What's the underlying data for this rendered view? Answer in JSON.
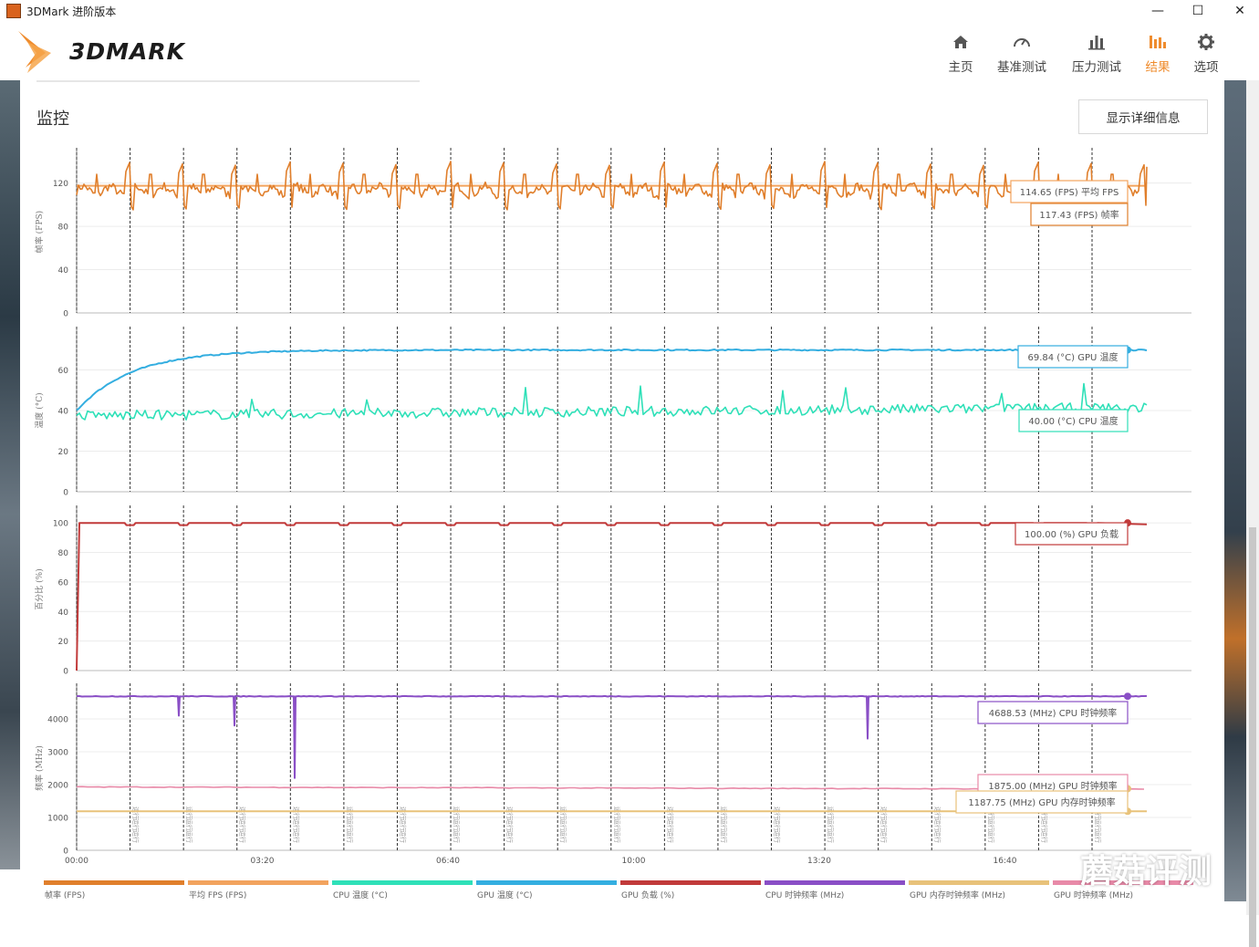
{
  "window": {
    "title": "3DMark 进阶版本",
    "minimize_glyph": "—",
    "maximize_glyph": "☐",
    "close_glyph": "✕"
  },
  "header": {
    "logo_text": "3DMARK",
    "nav": [
      {
        "label": "主页",
        "icon": "home-icon"
      },
      {
        "label": "基准测试",
        "icon": "gauge-icon"
      },
      {
        "label": "压力测试",
        "icon": "bar-chart-icon"
      },
      {
        "label": "结果",
        "icon": "results-icon",
        "active": true
      },
      {
        "label": "选项",
        "icon": "gear-icon"
      }
    ]
  },
  "monitor": {
    "title": "监控",
    "detail_button": "显示详细信息"
  },
  "watermark": "蘑菇评测",
  "colors": {
    "accent": "#ef8c2e",
    "fps": "#e07f2c",
    "avg_fps": "#f2a35e",
    "cpu_temp": "#2fe0b8",
    "gpu_temp": "#34aee0",
    "gpu_load": "#c13a3a",
    "cpu_clock": "#8a4fc6",
    "gpu_mem_clock": "#e8c27a",
    "gpu_clock": "#e88aa8"
  },
  "chart_data": [
    {
      "type": "line",
      "ylabel": "帧率 (FPS)",
      "ylim": [
        0,
        150
      ],
      "yticks": [
        0,
        40,
        80,
        120
      ],
      "series": [
        {
          "name": "帧率 (FPS)",
          "pattern": "periodic spikes",
          "base": 115,
          "amplitude_high": 140,
          "amplitude_low": 96
        },
        {
          "name": "平均 FPS (FPS)",
          "values": [
            117.43
          ]
        }
      ],
      "callouts": [
        "114.65 (FPS) 平均 FPS",
        "117.43 (FPS) 帧率"
      ]
    },
    {
      "type": "line",
      "ylabel": "温度 (°C)",
      "ylim": [
        0,
        80
      ],
      "yticks": [
        0,
        20,
        40,
        60
      ],
      "series": [
        {
          "name": "GPU 温度 (°C)",
          "start": 40,
          "end": 69.84
        },
        {
          "name": "CPU 温度 (°C)",
          "base": 40,
          "noise": 7
        }
      ],
      "callouts": [
        "69.84 (°C) GPU 温度",
        "40.00 (°C) CPU 温度"
      ]
    },
    {
      "type": "line",
      "ylabel": "百分比 (%)",
      "ylim": [
        0,
        110
      ],
      "yticks": [
        0,
        20,
        40,
        60,
        80,
        100
      ],
      "series": [
        {
          "name": "GPU 负载 (%)",
          "values": [
            100
          ]
        }
      ],
      "callouts": [
        "100.00 (%) GPU 负载"
      ]
    },
    {
      "type": "line",
      "ylabel": "频率 (MHz)",
      "ylim": [
        0,
        5000
      ],
      "yticks": [
        0,
        1000,
        2000,
        3000,
        4000
      ],
      "series": [
        {
          "name": "CPU 时钟频率 (MHz)",
          "values": [
            4688.53
          ]
        },
        {
          "name": "GPU 时钟频率 (MHz)",
          "values": [
            1875.0
          ]
        },
        {
          "name": "GPU 内存时钟频率 (MHz)",
          "values": [
            1187.75
          ]
        }
      ],
      "callouts": [
        "4688.53 (MHz) CPU 时钟频率",
        "1875.00 (MHz) GPU 时钟频率",
        "1187.75 (MHz) GPU 内存时钟频率"
      ]
    }
  ],
  "x_axis": {
    "ticks": [
      "00:00",
      "03:20",
      "06:40",
      "10:00",
      "13:20",
      "16:40"
    ],
    "marker_count": 20,
    "marker_label": "运行"
  },
  "legend": [
    {
      "label": "帧率 (FPS)",
      "color": "#e07f2c"
    },
    {
      "label": "平均 FPS (FPS)",
      "color": "#f2a35e"
    },
    {
      "label": "CPU 温度 (°C)",
      "color": "#2fe0b8"
    },
    {
      "label": "GPU 温度 (°C)",
      "color": "#34aee0"
    },
    {
      "label": "GPU 负载 (%)",
      "color": "#c13a3a"
    },
    {
      "label": "CPU 时钟频率 (MHz)",
      "color": "#8a4fc6"
    },
    {
      "label": "GPU 内存时钟频率 (MHz)",
      "color": "#e8c27a"
    },
    {
      "label": "GPU 时钟频率 (MHz)",
      "color": "#e88aa8"
    }
  ]
}
